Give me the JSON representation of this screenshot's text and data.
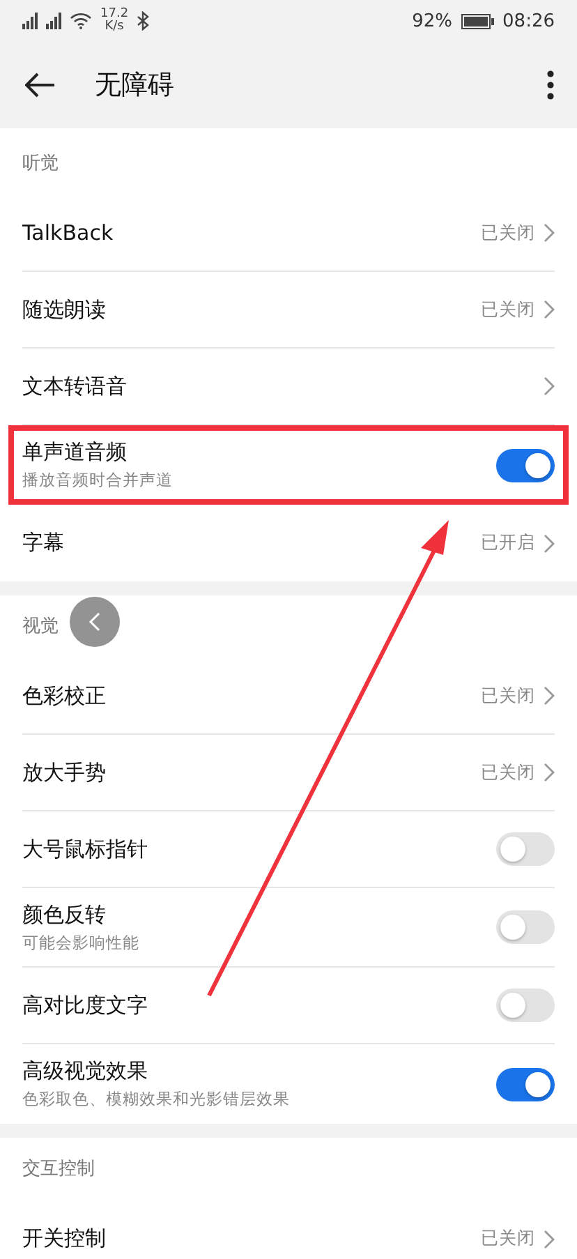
{
  "status_bar": {
    "net_speed": "17.2",
    "net_unit": "K/s",
    "battery": "92%",
    "time": "08:26"
  },
  "header": {
    "title": "无障碍"
  },
  "sections": [
    {
      "title": "听觉",
      "items": [
        {
          "kind": "link",
          "label": "TalkBack",
          "value": "已关闭",
          "highlighted": false
        },
        {
          "kind": "link",
          "label": "随选朗读",
          "value": "已关闭",
          "highlighted": false
        },
        {
          "kind": "link",
          "label": "文本转语音",
          "highlighted": false
        },
        {
          "kind": "toggle",
          "label": "单声道音频",
          "subtitle": "播放音频时合并声道",
          "on": true,
          "highlighted": true
        },
        {
          "kind": "link",
          "label": "字幕",
          "value": "已开启",
          "highlighted": false
        }
      ]
    },
    {
      "title": "视觉",
      "items": [
        {
          "kind": "link",
          "label": "色彩校正",
          "value": "已关闭",
          "highlighted": false
        },
        {
          "kind": "link",
          "label": "放大手势",
          "value": "已关闭",
          "highlighted": false
        },
        {
          "kind": "toggle",
          "label": "大号鼠标指针",
          "on": false,
          "highlighted": false
        },
        {
          "kind": "toggle",
          "label": "颜色反转",
          "subtitle": "可能会影响性能",
          "on": false,
          "highlighted": false
        },
        {
          "kind": "toggle",
          "label": "高对比度文字",
          "on": false,
          "highlighted": false
        },
        {
          "kind": "toggle",
          "label": "高级视觉效果",
          "subtitle": "色彩取色、模糊效果和光影错层效果",
          "on": true,
          "highlighted": false
        }
      ]
    },
    {
      "title": "交互控制",
      "items": [
        {
          "kind": "link",
          "label": "开关控制",
          "value": "已关闭",
          "highlighted": false
        }
      ]
    }
  ]
}
